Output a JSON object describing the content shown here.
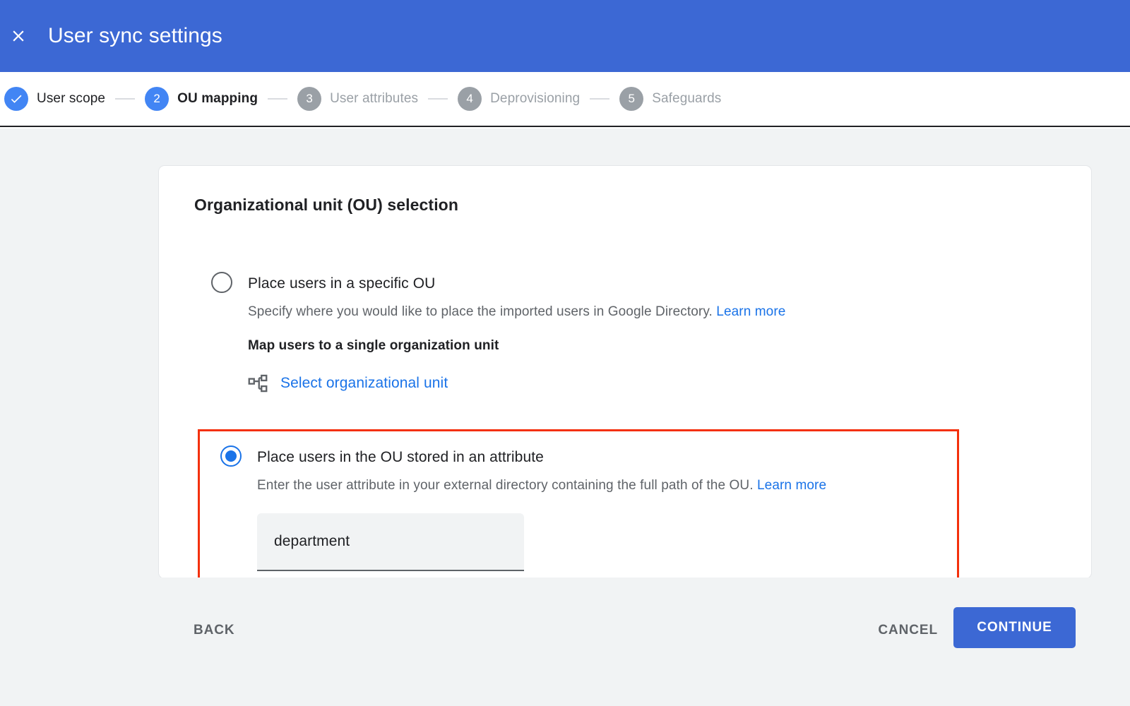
{
  "appbar": {
    "close_icon": "close-icon",
    "title": "User sync settings",
    "background_color": "#3c68d4"
  },
  "stepper": {
    "steps": [
      {
        "index": "1",
        "marker": "check",
        "label": "User scope",
        "state": "done"
      },
      {
        "index": "2",
        "marker": "2",
        "label": "OU mapping",
        "state": "active"
      },
      {
        "index": "3",
        "marker": "3",
        "label": "User attributes",
        "state": "todo"
      },
      {
        "index": "4",
        "marker": "4",
        "label": "Deprovisioning",
        "state": "todo"
      },
      {
        "index": "5",
        "marker": "5",
        "label": "Safeguards",
        "state": "todo"
      }
    ],
    "active_color": "#4285f4",
    "inactive_color": "#9aa0a6"
  },
  "card": {
    "title": "Organizational unit (OU) selection",
    "options": [
      {
        "id": "specific-ou",
        "selected": false,
        "label": "Place users in a specific OU",
        "description": "Specify where you would like to place the imported users in Google Directory.",
        "learn_more": "Learn more",
        "sub_heading": "Map users to a single organization unit",
        "ou_picker_icon": "account-tree-icon",
        "ou_picker_label": "Select organizational unit"
      },
      {
        "id": "ou-from-attribute",
        "selected": true,
        "label": "Place users in the OU stored in an attribute",
        "description": "Enter the user attribute in your external directory containing the full path of the OU.",
        "learn_more": "Learn more",
        "field": {
          "value": "department",
          "placeholder": "Attribute name"
        },
        "highlight_color": "#f4300c"
      }
    ]
  },
  "footer": {
    "back": "BACK",
    "cancel": "CANCEL",
    "continue": "CONTINUE",
    "continue_color": "#3c68d4"
  }
}
